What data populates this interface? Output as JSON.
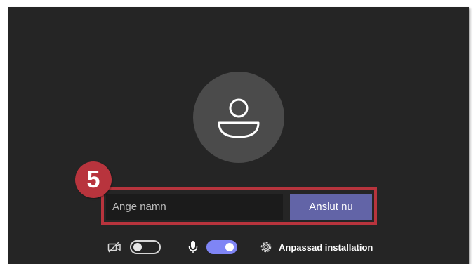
{
  "annotation": {
    "step_number": "5",
    "accent_color": "#b8343d"
  },
  "profile": {
    "avatar_icon": "person-icon"
  },
  "join": {
    "name_placeholder": "Ange namn",
    "name_value": "",
    "join_label": "Anslut nu",
    "button_color": "#6264a7"
  },
  "controls": {
    "camera_icon": "camera-off-icon",
    "camera_enabled": false,
    "mic_icon": "microphone-icon",
    "mic_enabled": true,
    "toggle_on_color": "#7f85f5",
    "settings_icon": "gear-icon",
    "settings_label": "Anpassad installation"
  },
  "theme": {
    "panel_background": "#252525",
    "avatar_background": "#4b4b4b"
  }
}
